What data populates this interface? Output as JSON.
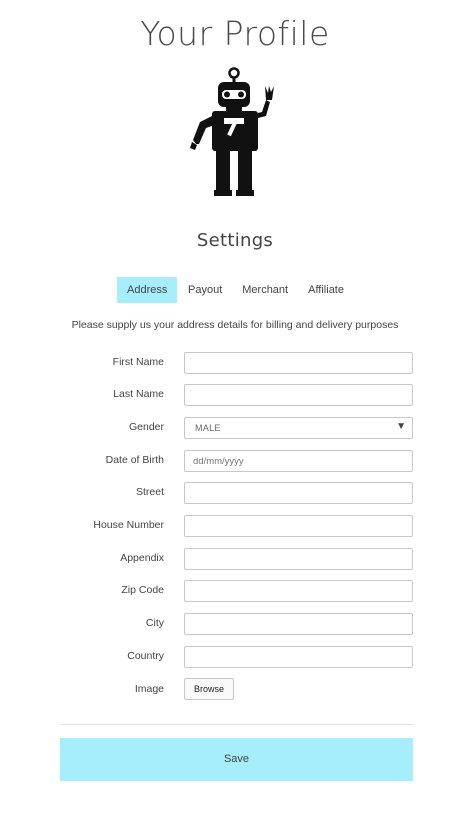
{
  "header": {
    "title": "Your Profile",
    "subtitle": "Settings"
  },
  "avatar": {
    "icon": "robot-waving-icon"
  },
  "tabs": [
    {
      "label": "Address",
      "active": true
    },
    {
      "label": "Payout",
      "active": false
    },
    {
      "label": "Merchant",
      "active": false
    },
    {
      "label": "Affiliate",
      "active": false
    }
  ],
  "intro_text": "Please supply us your address details for billing and delivery purposes",
  "form": {
    "first_name": {
      "label": "First Name",
      "value": ""
    },
    "last_name": {
      "label": "Last Name",
      "value": ""
    },
    "gender": {
      "label": "Gender",
      "value": "MALE"
    },
    "date_of_birth": {
      "label": "Date of Birth",
      "placeholder": "dd/mm/yyyy",
      "value": ""
    },
    "street": {
      "label": "Street",
      "value": ""
    },
    "house_number": {
      "label": "House Number",
      "value": ""
    },
    "appendix": {
      "label": "Appendix",
      "value": ""
    },
    "zip_code": {
      "label": "Zip Code",
      "value": ""
    },
    "city": {
      "label": "City",
      "value": ""
    },
    "country": {
      "label": "Country",
      "value": ""
    },
    "image": {
      "label": "Image",
      "button": "Browse"
    }
  },
  "actions": {
    "save_label": "Save"
  },
  "colors": {
    "accent": "#a6eefc",
    "text": "#444444",
    "border": "#c8c8c8"
  }
}
